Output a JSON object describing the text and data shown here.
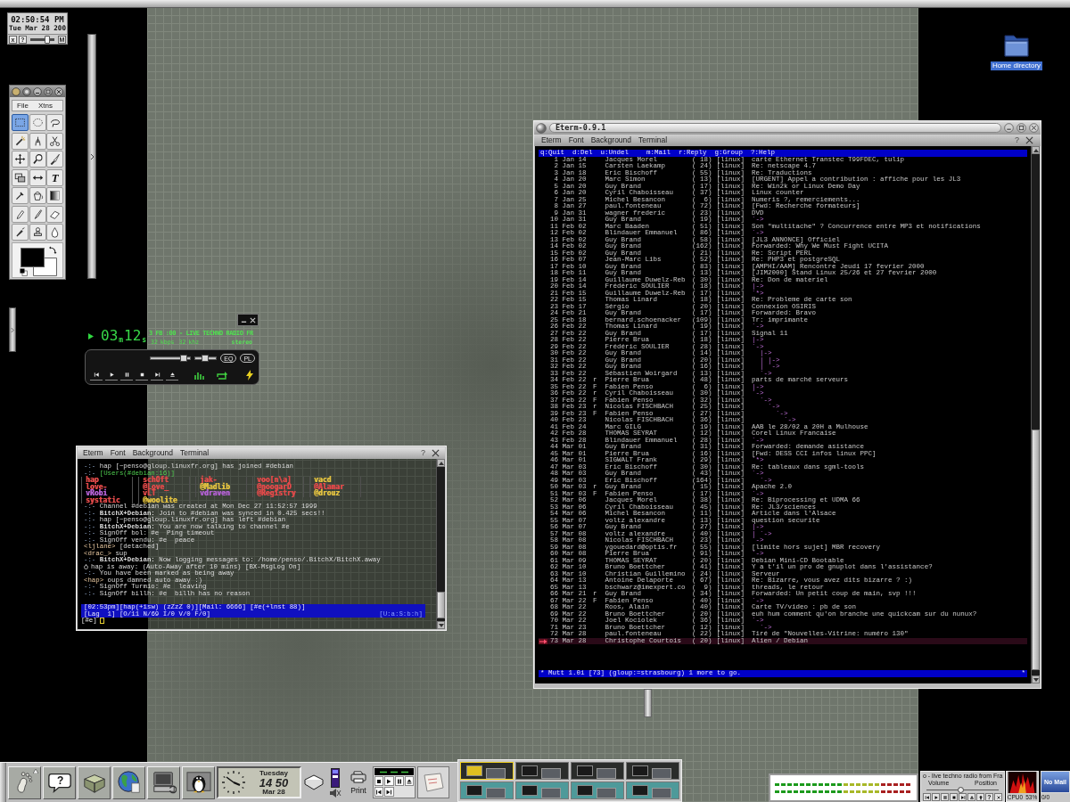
{
  "clock": {
    "time": "02:50:54 PM",
    "date": "Tue Mar 28 200",
    "left_buttons": [
      "x",
      "?"
    ],
    "slider": {
      "level": 0.7
    },
    "right_button": "M"
  },
  "tool_palette": {
    "menu": [
      "File",
      "Xtns"
    ],
    "tools": [
      {
        "kind": "rect-select",
        "selected": true
      },
      {
        "kind": "ellipse-select",
        "selected": false
      },
      {
        "kind": "lasso",
        "selected": false
      },
      {
        "kind": "wand",
        "selected": false
      },
      {
        "kind": "path",
        "selected": false
      },
      {
        "kind": "scissors",
        "selected": false
      },
      {
        "kind": "move",
        "selected": false
      },
      {
        "kind": "zoom",
        "selected": false
      },
      {
        "kind": "crop",
        "selected": false
      },
      {
        "kind": "transform",
        "selected": false
      },
      {
        "kind": "flip",
        "selected": false
      },
      {
        "kind": "text",
        "glyph": "T",
        "selected": false
      },
      {
        "kind": "picker",
        "selected": false
      },
      {
        "kind": "fill",
        "selected": false
      },
      {
        "kind": "gradient",
        "selected": false
      },
      {
        "kind": "pencil",
        "selected": false
      },
      {
        "kind": "brush",
        "selected": false
      },
      {
        "kind": "eraser",
        "selected": false
      },
      {
        "kind": "airbrush",
        "selected": false
      },
      {
        "kind": "clone",
        "selected": false
      },
      {
        "kind": "drop",
        "selected": false
      }
    ],
    "foreground": {
      "color": "#000000"
    },
    "background": {
      "color": "#ffffff"
    }
  },
  "media_player": {
    "minutes": "03",
    "minutes_unit": "m",
    "seconds": "12",
    "seconds_unit": "s",
    "ticker": "3 FB :00 - LIVE TECHNO RADIO FR",
    "rate": "32",
    "rate_unit": "kbps",
    "freq": "32",
    "freq_unit": "khz",
    "mode": "stereo",
    "volume": {
      "level": 0.85
    },
    "balance": {
      "level": 0.5
    },
    "toggles": [
      "EQ",
      "PL"
    ],
    "controls": [
      {
        "kind": "prev"
      },
      {
        "kind": "play"
      },
      {
        "kind": "pause"
      },
      {
        "kind": "stop"
      },
      {
        "kind": "next"
      },
      {
        "kind": "eject"
      }
    ]
  },
  "irc_window": {
    "menu": [
      "Eterm",
      "Font",
      "Background",
      "Terminal"
    ],
    "help": "?",
    "lines": [
      {
        "kind": "event",
        "prefix": "-:-",
        "text": "hap [~penso@gloup.linuxfr.org] has joined #debian"
      },
      {
        "kind": "users-header",
        "prefix": "-:-",
        "text": "[Users(#debian:16)]"
      },
      {
        "kind": "users-row",
        "nicks": [
          {
            "nick": "hap",
            "color": "#e04a4a"
          },
          {
            "nick": "schOft",
            "color": "#e04a4a"
          },
          {
            "nick": "jak-",
            "color": "#e04a4a"
          },
          {
            "nick": "voo[n\\a]",
            "color": "#e04a4a"
          },
          {
            "nick": "vacd",
            "color": "#e0c040"
          }
        ]
      },
      {
        "kind": "users-row",
        "nicks": [
          {
            "nick": "love-",
            "color": "#e04a4a"
          },
          {
            "nick": "@Love_",
            "color": "#e04a4a"
          },
          {
            "nick": "@Madlib",
            "color": "#e0c040"
          },
          {
            "nick": "@noogarD",
            "color": "#e04a4a"
          },
          {
            "nick": "@Alamar",
            "color": "#e04a4a"
          }
        ]
      },
      {
        "kind": "users-row",
        "nicks": [
          {
            "nick": "vRobi",
            "color": "#b060d0"
          },
          {
            "nick": "vLT",
            "color": "#e04a4a"
          },
          {
            "nick": "vdraven",
            "color": "#b060d0"
          },
          {
            "nick": "@Registry",
            "color": "#e04a4a"
          },
          {
            "nick": "@drouz",
            "color": "#e0c040"
          }
        ]
      },
      {
        "kind": "users-row",
        "nicks": [
          {
            "nick": "systatic",
            "color": "#e04a4a"
          },
          {
            "nick": "@woolite",
            "color": "#e0c040"
          }
        ]
      },
      {
        "kind": "event",
        "prefix": "-:-",
        "text": "Channel #debian was created at Mon Dec 27 11:52:57 1999"
      },
      {
        "kind": "event",
        "prefix": "-:-",
        "text": "**BitchX+Debian:** Join to #debian was synced in 0.425 secs!!"
      },
      {
        "kind": "event",
        "prefix": "-:-",
        "text": "hap [~penso@gloup.linuxfr.org] has left #debian"
      },
      {
        "kind": "event",
        "prefix": "-:-",
        "text": "**BitchX+Debian:** You are now talking to channel #e"
      },
      {
        "kind": "event",
        "prefix": "-:-",
        "text": "SignOff bol: #e  Ping timeout"
      },
      {
        "kind": "event",
        "prefix": "-:-",
        "text": "SignOff vendu: #e  peace"
      },
      {
        "kind": "message",
        "prefix": "<ljlane>",
        "text": "[detached]"
      },
      {
        "kind": "message",
        "prefix": "<drac_>",
        "text": "sup"
      },
      {
        "kind": "event",
        "prefix": "-:-",
        "text": "**BitchX+Debian:** Now logging messages to: /home/penso/.BitchX/BitchX.away"
      },
      {
        "kind": "away",
        "text": "hap is away: (Auto-Away after 10 mins) [BX-MsgLog On]"
      },
      {
        "kind": "event",
        "prefix": "-:-",
        "text": "You have been marked as being away"
      },
      {
        "kind": "message",
        "prefix": "<hap>",
        "text": "oups damned auto away :)"
      },
      {
        "kind": "event",
        "prefix": "-:-",
        "text": "SignOff Turmio: #e  leaving"
      },
      {
        "kind": "event",
        "prefix": "-:-",
        "text": "SignOff billh: #e  billh has no reason"
      }
    ],
    "status_line_1": "[02:53pm][hap(+isw) (zZzZ 0)][Mail: 6666] [#e(+lnst 88)]",
    "status_line_2": "[Lag  1] [O/11 N/69 I/0 V/0 F/0]",
    "status_right": "[U:a:S:b:h]",
    "prompt": "[#e]"
  },
  "mutt_window": {
    "title": "Eterm-0.9.1",
    "menu": [
      "Eterm",
      "Font",
      "Background",
      "Terminal"
    ],
    "help": "?",
    "help_bar": [
      "q:Quit",
      "d:Del",
      "u:Undel",
      "m:Mail",
      "r:Reply",
      "g:Group",
      "?:Help"
    ],
    "rows": [
      {
        "number": "1",
        "date": "Jan 14",
        "author": "Jacques Morel",
        "size": "( 18)",
        "list": "[linux]",
        "subject": "carte Ethernet Transtec T99FDEC, tulip",
        "selected": false
      },
      {
        "number": "2",
        "date": "Jan 15",
        "author": "Carsten Laekamp",
        "size": "( 24)",
        "list": "[linux]",
        "subject": "Re: netscape 4.7",
        "selected": false
      },
      {
        "number": "3",
        "date": "Jan 18",
        "author": "Eric Bischoff",
        "size": "( 55)",
        "list": "[linux]",
        "subject": "Re: Traductions",
        "selected": false
      },
      {
        "number": "4",
        "date": "Jan 20",
        "author": "Marc Simon",
        "size": "( 13)",
        "list": "[linux]",
        "subject": "[URGENT] Appel a contribution : affiche pour les JL3",
        "selected": false
      },
      {
        "number": "5",
        "date": "Jan 20",
        "author": "Guy Brand",
        "size": "( 17)",
        "list": "[linux]",
        "subject": "Re: Win2k or Linux Demo Day",
        "selected": false
      },
      {
        "number": "6",
        "date": "Jan 20",
        "author": "Cyril Chaboisseau",
        "size": "( 37)",
        "list": "[linux]",
        "subject": "Linux counter",
        "selected": false
      },
      {
        "number": "7",
        "date": "Jan 25",
        "author": "Michel Besancon",
        "size": "(  6)",
        "list": "[linux]",
        "subject": "Numeris ?, remerciements...",
        "selected": false
      },
      {
        "number": "8",
        "date": "Jan 27",
        "author": "paul.fonteneau",
        "size": "( 72)",
        "list": "[linux]",
        "subject": "[Fwd: Recherche formateurs]",
        "selected": false
      },
      {
        "number": "9",
        "date": "Jan 31",
        "author": "wagner frederic",
        "size": "( 23)",
        "list": "[linux]",
        "subject": "DVD",
        "selected": false
      },
      {
        "number": "10",
        "date": "Jan 31",
        "author": "Guy Brand",
        "size": "( 19)",
        "list": "[linux]",
        "tree": "`->",
        "selected": false
      },
      {
        "number": "11",
        "date": "Feb 02",
        "author": "Marc Baaden",
        "size": "( 51)",
        "list": "[linux]",
        "subject": "Son \"multitache\" ? Concurrence entre MP3 et notifications",
        "selected": false
      },
      {
        "number": "12",
        "date": "Feb 02",
        "author": "Blindauer Emmanuel",
        "size": "( 86)",
        "list": "[linux]",
        "tree": "`->",
        "selected": false
      },
      {
        "number": "13",
        "date": "Feb 02",
        "author": "Guy Brand",
        "size": "( 58)",
        "list": "[linux]",
        "subject": "[JL3 ANNONCE] Officiel",
        "selected": false
      },
      {
        "number": "14",
        "date": "Feb 02",
        "author": "Guy Brand",
        "size": "(162)",
        "list": "[linux]",
        "subject": "Forwarded: Why We Must Fight UCITA",
        "selected": false
      },
      {
        "number": "15",
        "date": "Feb 02",
        "author": "Guy Brand",
        "size": "( 21)",
        "list": "[linux]",
        "subject": "Re: Script PERL",
        "selected": false
      },
      {
        "number": "16",
        "date": "Feb 07",
        "author": "Jean-Marc Libs",
        "size": "( 52)",
        "list": "[linux]",
        "subject": "Re: PHP3 et postgreSQL",
        "selected": false
      },
      {
        "number": "17",
        "date": "Feb 10",
        "author": "Guy Brand",
        "size": "( 83)",
        "list": "[linux]",
        "subject": "[AMPHI/AAM] Rencontre Jeudi 17 fevrier 2000",
        "selected": false
      },
      {
        "number": "18",
        "date": "Feb 11",
        "author": "Guy Brand",
        "size": "( 13)",
        "list": "[linux]",
        "subject": "[JIM2000] Stand Linux 25/26 et 27 fevrier 2000",
        "selected": false
      },
      {
        "number": "19",
        "date": "Feb 14",
        "author": "Guillaume Duwelz-Reb",
        "size": "( 30)",
        "list": "[linux]",
        "subject": "Re: Don de materiel",
        "selected": false
      },
      {
        "number": "20",
        "date": "Feb 14",
        "author": "Frédéric SOULIER",
        "size": "( 18)",
        "list": "[linux]",
        "tree": "|->",
        "selected": false
      },
      {
        "number": "21",
        "date": "Feb 15",
        "author": "Guillaume Duwelz-Reb",
        "size": "( 17)",
        "list": "[linux]",
        "tree": "`*>",
        "selected": false
      },
      {
        "number": "22",
        "date": "Feb 15",
        "author": "Thomas Linard",
        "size": "( 18)",
        "list": "[linux]",
        "subject": "Re: Probleme de carte son",
        "selected": false
      },
      {
        "number": "23",
        "date": "Feb 17",
        "author": "Sérgio",
        "size": "( 20)",
        "list": "[linux]",
        "subject": "Connexion OSIRIS",
        "selected": false
      },
      {
        "number": "24",
        "date": "Feb 21",
        "author": "Guy Brand",
        "size": "( 17)",
        "list": "[linux]",
        "subject": "Forwarded: Bravo",
        "selected": false
      },
      {
        "number": "25",
        "date": "Feb 18",
        "author": "bernard.schoenacker",
        "size": "(109)",
        "list": "[linux]",
        "subject": "Tr: imprimante",
        "selected": false
      },
      {
        "number": "26",
        "date": "Feb 22",
        "author": "Thomas Linard",
        "size": "( 19)",
        "list": "[linux]",
        "tree": "`->",
        "selected": false
      },
      {
        "number": "27",
        "date": "Feb 22",
        "author": "Guy Brand",
        "size": "( 17)",
        "list": "[linux]",
        "subject": "Signal 11",
        "selected": false
      },
      {
        "number": "28",
        "date": "Feb 22",
        "author": "Pierre Brua",
        "size": "( 18)",
        "list": "[linux]",
        "tree": "|->",
        "selected": false
      },
      {
        "number": "29",
        "date": "Feb 22",
        "author": "Frédéric SOULIER",
        "size": "( 28)",
        "list": "[linux]",
        "tree": "`->",
        "selected": false
      },
      {
        "number": "30",
        "date": "Feb 22",
        "author": "Guy Brand",
        "size": "( 14)",
        "list": "[linux]",
        "tree": "  |->",
        "selected": false
      },
      {
        "number": "31",
        "date": "Feb 22",
        "author": "Guy Brand",
        "size": "( 20)",
        "list": "[linux]",
        "tree": "  | |->",
        "selected": false
      },
      {
        "number": "32",
        "date": "Feb 22",
        "author": "Guy Brand",
        "size": "( 16)",
        "list": "[linux]",
        "tree": "  | `->",
        "selected": false
      },
      {
        "number": "33",
        "date": "Feb 22",
        "author": "Sébastien Woirgard",
        "size": "( 13)",
        "list": "[linux]",
        "tree": "  `->",
        "selected": false
      },
      {
        "number": "34",
        "date": "Feb 22",
        "flag": "r",
        "author": "Pierre Brua",
        "size": "( 48)",
        "list": "[linux]",
        "subject": "parts de marché serveurs",
        "selected": false
      },
      {
        "number": "35",
        "date": "Feb 22",
        "flag": "F",
        "author": "Fabien Penso",
        "size": "(  6)",
        "list": "[linux]",
        "tree": "|->",
        "selected": false
      },
      {
        "number": "36",
        "date": "Feb 22",
        "flag": "r",
        "author": "Cyril Chaboisseau",
        "size": "( 30)",
        "list": "[linux]",
        "tree": "`->",
        "selected": false
      },
      {
        "number": "37",
        "date": "Feb 22",
        "flag": "F",
        "author": "Fabien Penso",
        "size": "( 32)",
        "list": "[linux]",
        "tree": "  `->",
        "selected": false
      },
      {
        "number": "38",
        "date": "Feb 23",
        "flag": "r",
        "author": "Nicolas FISCHBACH",
        "size": "( 25)",
        "list": "[linux]",
        "tree": "    `->",
        "selected": false
      },
      {
        "number": "39",
        "date": "Feb 23",
        "flag": "F",
        "author": "Fabien Penso",
        "size": "( 27)",
        "list": "[linux]",
        "tree": "      `->",
        "selected": false
      },
      {
        "number": "40",
        "date": "Feb 23",
        "author": "Nicolas FISCHBACH",
        "size": "( 36)",
        "list": "[linux]",
        "tree": "        `->",
        "selected": false
      },
      {
        "number": "41",
        "date": "Feb 24",
        "author": "Marc GILG",
        "size": "( 19)",
        "list": "[linux]",
        "subject": "AAB le 28/02 a 20H a Mulhouse",
        "selected": false
      },
      {
        "number": "42",
        "date": "Feb 28",
        "author": "THOMAS SEYRAT",
        "size": "( 12)",
        "list": "[linux]",
        "subject": "Corel Linux Francaise",
        "selected": false
      },
      {
        "number": "43",
        "date": "Feb 28",
        "author": "Blindauer Emmanuel",
        "size": "( 28)",
        "list": "[linux]",
        "tree": "`->",
        "selected": false
      },
      {
        "number": "44",
        "date": "Mar 01",
        "author": "Guy Brand",
        "size": "( 31)",
        "list": "[linux]",
        "subject": "Forwarded: demande asistance",
        "selected": false
      },
      {
        "number": "45",
        "date": "Mar 01",
        "author": "Pierre Brua",
        "size": "( 16)",
        "list": "[linux]",
        "subject": "[Fwd: DESS CCI infos linux PPC]",
        "selected": false
      },
      {
        "number": "46",
        "date": "Mar 01",
        "author": "SIGWALT Frank",
        "size": "( 29)",
        "list": "[linux]",
        "tree": "`*>",
        "selected": false
      },
      {
        "number": "47",
        "date": "Mar 03",
        "author": "Eric Bischoff",
        "size": "( 30)",
        "list": "[linux]",
        "subject": "Re: tableaux dans sgml-tools",
        "selected": false
      },
      {
        "number": "48",
        "date": "Mar 03",
        "author": "Guy Brand",
        "size": "( 43)",
        "list": "[linux]",
        "tree": "`->",
        "selected": false
      },
      {
        "number": "49",
        "date": "Mar 03",
        "author": "Eric Bischoff",
        "size": "(164)",
        "list": "[linux]",
        "tree": "  `->",
        "selected": false
      },
      {
        "number": "50",
        "date": "Mar 03",
        "flag": "r",
        "author": "Guy Brand",
        "size": "( 15)",
        "list": "[linux]",
        "subject": "Apache 2.0",
        "selected": false
      },
      {
        "number": "51",
        "date": "Mar 03",
        "flag": "F",
        "author": "Fabien Penso",
        "size": "( 17)",
        "list": "[linux]",
        "tree": "`->",
        "selected": false
      },
      {
        "number": "52",
        "date": "Mar 06",
        "author": "Jacques Morel",
        "size": "( 38)",
        "list": "[linux]",
        "subject": "Re: Biprocessing et UDMA 66",
        "selected": false
      },
      {
        "number": "53",
        "date": "Mar 06",
        "author": "Cyril Chaboisseau",
        "size": "( 45)",
        "list": "[linux]",
        "subject": "Re: JL3/sciences",
        "selected": false
      },
      {
        "number": "54",
        "date": "Mar 06",
        "author": "Michel Besancon",
        "size": "( 11)",
        "list": "[linux]",
        "subject": "Article dans l'Alsace",
        "selected": false
      },
      {
        "number": "55",
        "date": "Mar 07",
        "author": "voltz alexandre",
        "size": "( 13)",
        "list": "[linux]",
        "subject": "question securite",
        "selected": false
      },
      {
        "number": "56",
        "date": "Mar 07",
        "author": "Guy Brand",
        "size": "( 27)",
        "list": "[linux]",
        "tree": "|->",
        "selected": false
      },
      {
        "number": "57",
        "date": "Mar 08",
        "author": "voltz alexandre",
        "size": "( 40)",
        "list": "[linux]",
        "tree": "| `->",
        "selected": false
      },
      {
        "number": "58",
        "date": "Mar 08",
        "author": "Nicolas FISCHBACH",
        "size": "( 23)",
        "list": "[linux]",
        "tree": "`->",
        "selected": false
      },
      {
        "number": "59",
        "date": "Mar 08",
        "author": "ygouedard@optis.fr",
        "size": "( 55)",
        "list": "[linux]",
        "subject": "[limite hors sujet] MBR recovery",
        "selected": false
      },
      {
        "number": "60",
        "date": "Mar 08",
        "author": "Pierre Brua",
        "size": "( 91)",
        "list": "[linux]",
        "tree": "`->",
        "selected": false
      },
      {
        "number": "61",
        "date": "Mar 09",
        "author": "THOMAS SEYRAT",
        "size": "( 20)",
        "list": "[linux]",
        "subject": "Debian Mini-CD Bootable",
        "selected": false
      },
      {
        "number": "62",
        "date": "Mar 10",
        "author": "Bruno Boettcher",
        "size": "( 41)",
        "list": "[linux]",
        "subject": "Y a t'il un pro de gnuplot dans l'assistance?",
        "selected": false
      },
      {
        "number": "63",
        "date": "Mar 10",
        "author": "Christian Guillemino",
        "size": "( 24)",
        "list": "[linux]",
        "subject": "Serveur",
        "selected": false
      },
      {
        "number": "64",
        "date": "Mar 13",
        "author": "Antoine Delaporte",
        "size": "( 67)",
        "list": "[linux]",
        "subject": "Re: Bizarre, vous avez dits bizarre ? :)",
        "selected": false
      },
      {
        "number": "65",
        "date": "Mar 13",
        "author": "bschwarz@imexpert.co",
        "size": "(  9)",
        "list": "[linux]",
        "subject": "threads, le retour",
        "selected": false
      },
      {
        "number": "66",
        "date": "Mar 21",
        "flag": "r",
        "author": "Guy Brand",
        "size": "( 34)",
        "list": "[linux]",
        "subject": "Forwarded: Un petit coup de main, svp !!!",
        "selected": false
      },
      {
        "number": "67",
        "date": "Mar 22",
        "flag": "F",
        "author": "Fabien Penso",
        "size": "( 40)",
        "list": "[linux]",
        "tree": "`->",
        "selected": false
      },
      {
        "number": "68",
        "date": "Mar 22",
        "author": "Roos, Alain",
        "size": "( 40)",
        "list": "[linux]",
        "subject": "Carte TV/video : pb de son",
        "selected": false
      },
      {
        "number": "69",
        "date": "Mar 22",
        "author": "Bruno Boettcher",
        "size": "( 20)",
        "list": "[linux]",
        "subject": "euh hum comment qu'on branche une quickcam sur du nunux?",
        "selected": false
      },
      {
        "number": "70",
        "date": "Mar 22",
        "author": "Joel Kociolek",
        "size": "( 36)",
        "list": "[linux]",
        "tree": "`->",
        "selected": false
      },
      {
        "number": "71",
        "date": "Mar 23",
        "author": "Bruno Boettcher",
        "size": "( 12)",
        "list": "[linux]",
        "tree": "  `->",
        "selected": false
      },
      {
        "number": "72",
        "date": "Mar 28",
        "author": "paul.fonteneau",
        "size": "( 22)",
        "list": "[linux]",
        "subject": "Tiré de \"Nouvelles-Vitrine: numéro 130\"",
        "selected": false
      },
      {
        "number": "73",
        "date": "Mar 28",
        "author": "Christophe Courtois",
        "size": "( 20)",
        "list": "[linux]",
        "subject": "Alien / Debian",
        "selected": true
      }
    ],
    "status_left": "* Mutt 1.0i [73] (gloup:=strasbourg) 1 more to go.",
    "status_right": "*"
  },
  "desktop_icon": {
    "label": "Home directory"
  },
  "panel": {
    "launchers": [
      {
        "kind": "foot"
      },
      {
        "kind": "help",
        "glyph": "?"
      },
      {
        "kind": "toolbox"
      },
      {
        "kind": "globe"
      },
      {
        "kind": "computer"
      },
      {
        "kind": "penguin"
      }
    ],
    "clock": {
      "day": "Tuesday",
      "time": "14 50",
      "date": "Mar 28"
    },
    "printer": {
      "label": "Print"
    },
    "cd_player": {
      "buttons": [
        {
          "kind": "stop"
        },
        {
          "kind": "play"
        },
        {
          "kind": "pause"
        },
        {
          "kind": "eject"
        },
        {
          "kind": "prev"
        },
        {
          "kind": "next"
        }
      ]
    },
    "pager": {
      "desks": [
        {
          "selected": true
        },
        {
          "selected": false
        },
        {
          "selected": false
        },
        {
          "selected": false
        },
        {
          "selected": false
        },
        {
          "selected": false
        },
        {
          "selected": false
        },
        {
          "selected": false
        }
      ]
    },
    "radio": {
      "title": "o - live techno radio from Fra",
      "volume_label": "Volume",
      "position_label": "Position",
      "slider": {
        "level": 0.47
      },
      "buttons": [
        {
          "kind": "prev"
        },
        {
          "kind": "play"
        },
        {
          "kind": "pause"
        },
        {
          "kind": "stop"
        },
        {
          "kind": "next"
        },
        {
          "kind": "eject"
        },
        {
          "kind": "up"
        },
        {
          "kind": "help",
          "glyph": "?"
        },
        {
          "kind": "close"
        }
      ]
    },
    "cpu": {
      "label": "CPU0",
      "value": "53%"
    },
    "mail": {
      "status": "No Mail",
      "count": "0/0"
    }
  }
}
